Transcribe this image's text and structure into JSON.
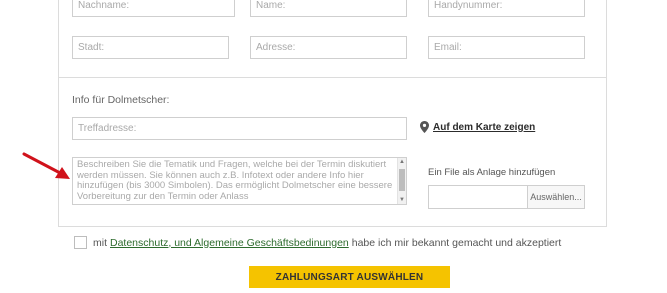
{
  "contact": {
    "row1": {
      "nachname_placeholder": "Nachname:",
      "name_placeholder": "Name:",
      "handy_placeholder": "Handynummer:"
    },
    "row2": {
      "stadt_placeholder": "Stadt:",
      "adresse_placeholder": "Adresse:",
      "email_placeholder": "Email:"
    }
  },
  "interpreter_info": {
    "title": "Info für Dolmetscher:",
    "treffadresse_placeholder": "Treffadresse:",
    "map_link": "Auf dem Karte zeigen",
    "description_placeholder": "Beschreiben Sie die Tematik und Fragen, welche bei der Termin diskutiert werden müssen. Sie können auch z.B. Infotext oder andere Info hier hinzufügen (bis 3000 Simbolen). Das ermöglicht Dolmetscher eine bessere Vorbereitung zur den Termin oder Anlass",
    "attachment_label": "Ein File als Anlage hinzufügen",
    "browse_button": "Auswählen..."
  },
  "consent": {
    "prefix": "mit",
    "link": "Datenschutz, und Algemeine Geschäftsbedinungen",
    "suffix": "habe ich mir bekannt gemacht und akzeptiert"
  },
  "submit_label": "ZAHLUNGSART AUSWÄHLEN",
  "colors": {
    "accent_button": "#f5c300",
    "link_green": "#2d6b2d",
    "annotation_arrow": "#d0121b"
  },
  "icons": [
    "map-pin-icon",
    "red-arrow-annotation"
  ]
}
